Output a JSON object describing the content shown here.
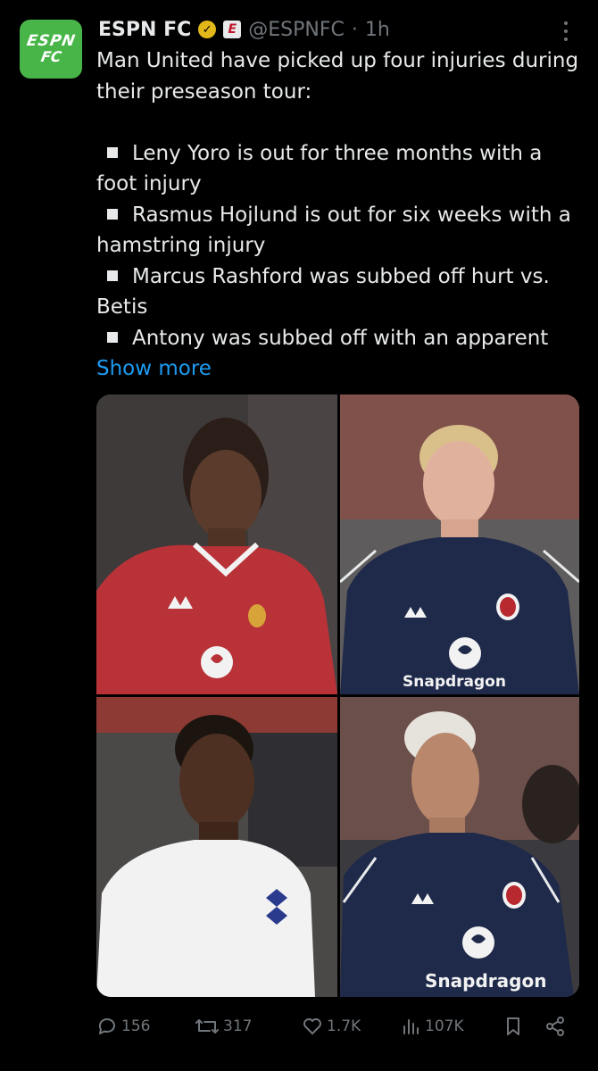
{
  "tweet": {
    "author_name": "ESPN FC",
    "handle": "@ESPNFC",
    "separator": "·",
    "time": "1h",
    "avatar": {
      "line1": "ESPN",
      "line2": "FC",
      "color": "#48b548"
    },
    "verified_badge_color": "#e2b719",
    "affiliate_badge_letter": "E",
    "intro": "Man United have picked up four injuries during their preseason tour:",
    "bullets": [
      "Leny Yoro is out for three months with a foot injury",
      "Rasmus Hojlund is out for six weeks with a hamstring injury",
      "Marcus Rashford was subbed off hurt vs. Betis",
      "Antony was subbed off with an apparent"
    ],
    "show_more": "Show more"
  },
  "media": {
    "photos": [
      {
        "name": "yoro-photo",
        "shirt_color": "#b83238",
        "shirt_text": ""
      },
      {
        "name": "hojlund-photo",
        "shirt_color": "#1f2a4a",
        "shirt_text": "Snapdragon"
      },
      {
        "name": "rashford-photo",
        "shirt_color": "#f2f2f2",
        "shirt_text": ""
      },
      {
        "name": "antony-photo",
        "shirt_color": "#1f2a4a",
        "shirt_text": "Snapdragon"
      }
    ]
  },
  "actions": {
    "replies": "156",
    "reposts": "317",
    "likes": "1.7K",
    "views": "107K"
  },
  "colors": {
    "accent": "#1d9bf0",
    "muted": "#71767b",
    "text": "#e7e9ea",
    "background": "#000000"
  }
}
